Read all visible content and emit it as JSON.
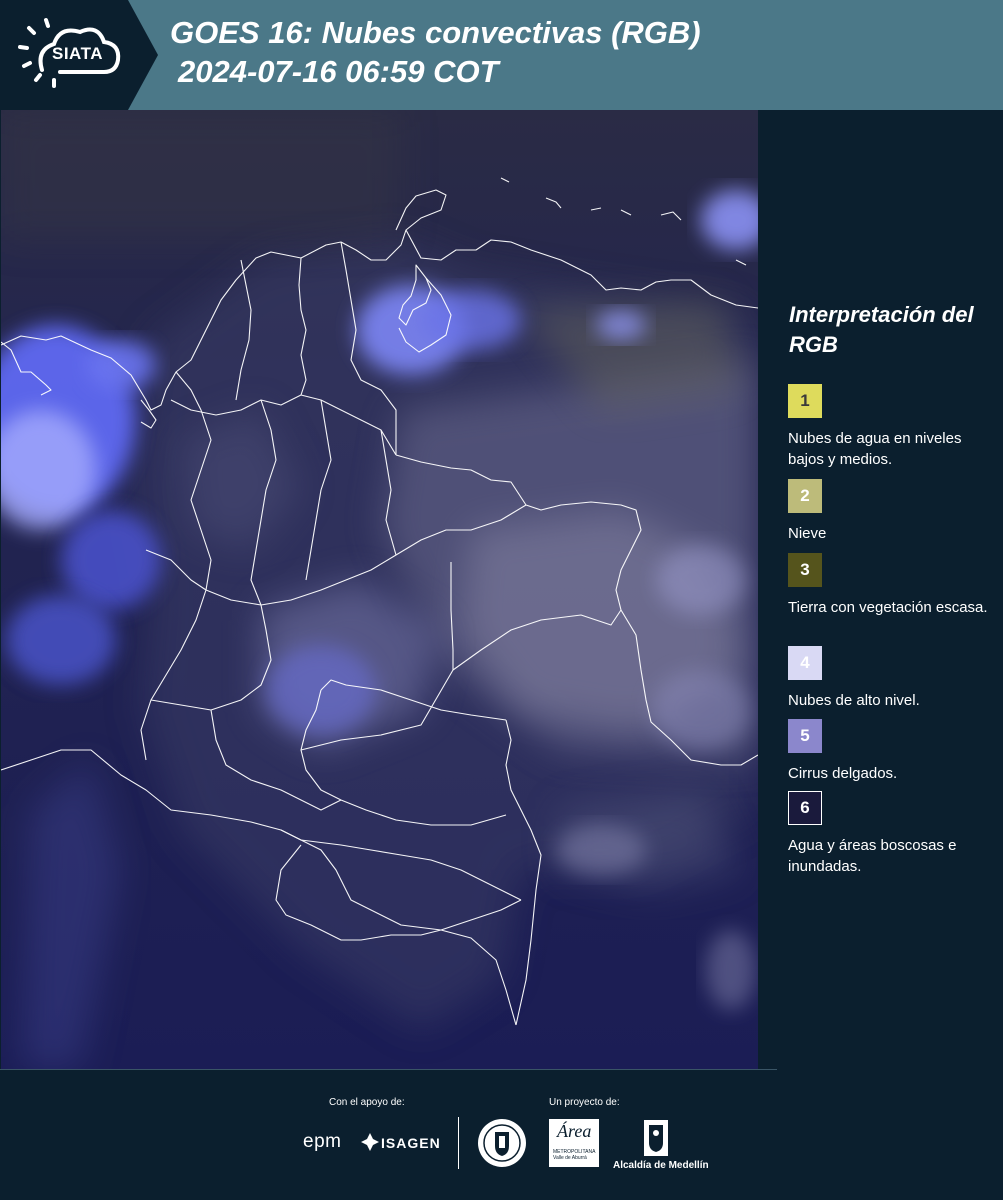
{
  "header": {
    "logo_text": "SIATA",
    "title": "GOES 16: Nubes convectivas (RGB)",
    "subtitle": "2024-07-16 06:59 COT"
  },
  "legend": {
    "title": "Interpretación del RGB",
    "items": [
      {
        "number": "1",
        "label": "Nubes de agua en niveles bajos y medios.",
        "color": "#dedb5c"
      },
      {
        "number": "2",
        "label": "Nieve",
        "color": "#bdbb7a"
      },
      {
        "number": "3",
        "label": "Tierra con vegetación escasa.",
        "color": "#55541c"
      },
      {
        "number": "4",
        "label": "Nubes de alto nivel.",
        "color": "#d9d9f4"
      },
      {
        "number": "5",
        "label": "Cirrus delgados.",
        "color": "#8b87cc"
      },
      {
        "number": "6",
        "label": "Agua y áreas boscosas e inundadas.",
        "color": "#1a1a3c"
      }
    ]
  },
  "footer": {
    "support_label": "Con el apoyo de:",
    "project_label": "Un proyecto de:",
    "epm": "epm",
    "isagen": "ISAGEN",
    "area_word": "Área",
    "area_small": "METROPOLITANA Valle de Aburrá",
    "alcaldia": "Alcaldía de Medellín"
  },
  "colors": {
    "header_bg": "#4b7888",
    "logo_bg": "#0b1f2e",
    "page_bg": "#0b1f2e",
    "map_bg": "#1d2056"
  }
}
